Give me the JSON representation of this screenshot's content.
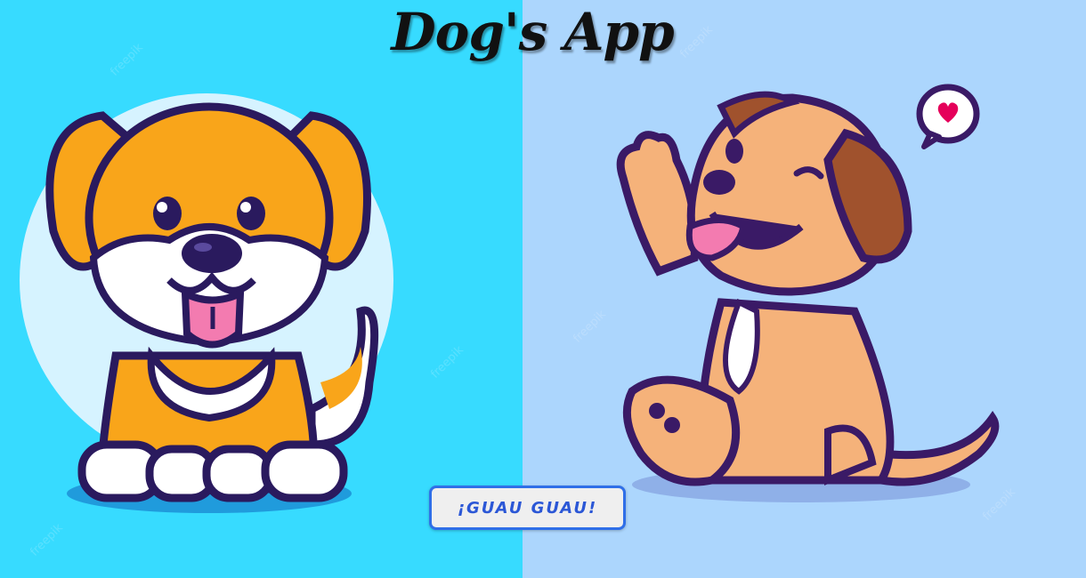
{
  "app": {
    "title": "Dog's App"
  },
  "actions": {
    "bark_label": "¡GUAU GUAU!"
  },
  "images": [
    {
      "description_icon": "orange-puppy-illustration-icon"
    },
    {
      "description_icon": "waving-puppy-illustration-icon"
    }
  ],
  "watermark": "freepik",
  "colors": {
    "left_background": "#37dbff",
    "right_background": "#acd6fd",
    "button_border": "#2f6fe8",
    "button_text": "#2b57d6",
    "button_fill": "#efefef"
  }
}
